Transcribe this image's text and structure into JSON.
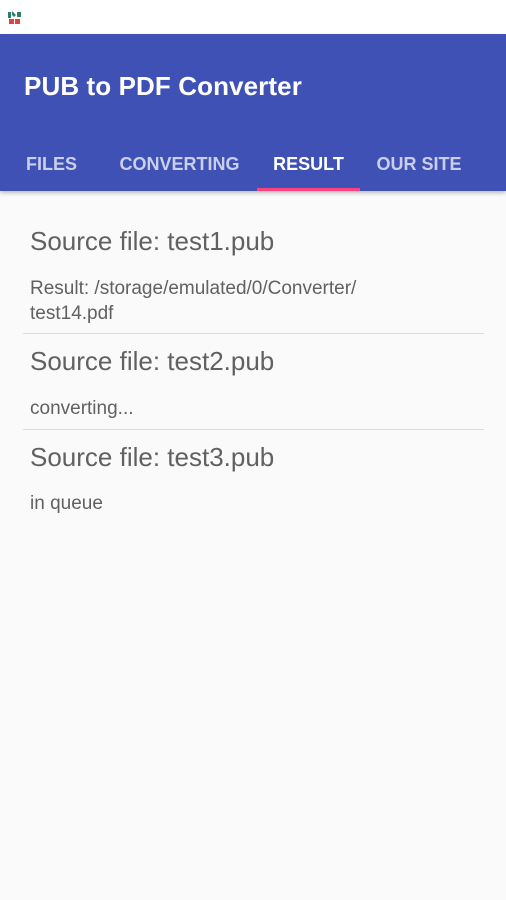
{
  "app": {
    "title": "PUB to PDF Converter"
  },
  "status_bar": {
    "app_icon": "app-logo-icon"
  },
  "tabs": [
    {
      "label": "FILES",
      "active": false
    },
    {
      "label": "CONVERTING",
      "active": false
    },
    {
      "label": "RESULT",
      "active": true
    },
    {
      "label": "OUR SITE",
      "active": false
    }
  ],
  "results": [
    {
      "source": "Source file: test1.pub",
      "status": "Result: /storage/emulated/0/Converter/\ntest14.pdf"
    },
    {
      "source": "Source file: test2.pub",
      "status": "converting..."
    },
    {
      "source": "Source file: test3.pub",
      "status": "in queue"
    }
  ],
  "colors": {
    "primary": "#3f51b5",
    "accent": "#ff4081",
    "background": "#fafafa",
    "text": "#616161"
  }
}
